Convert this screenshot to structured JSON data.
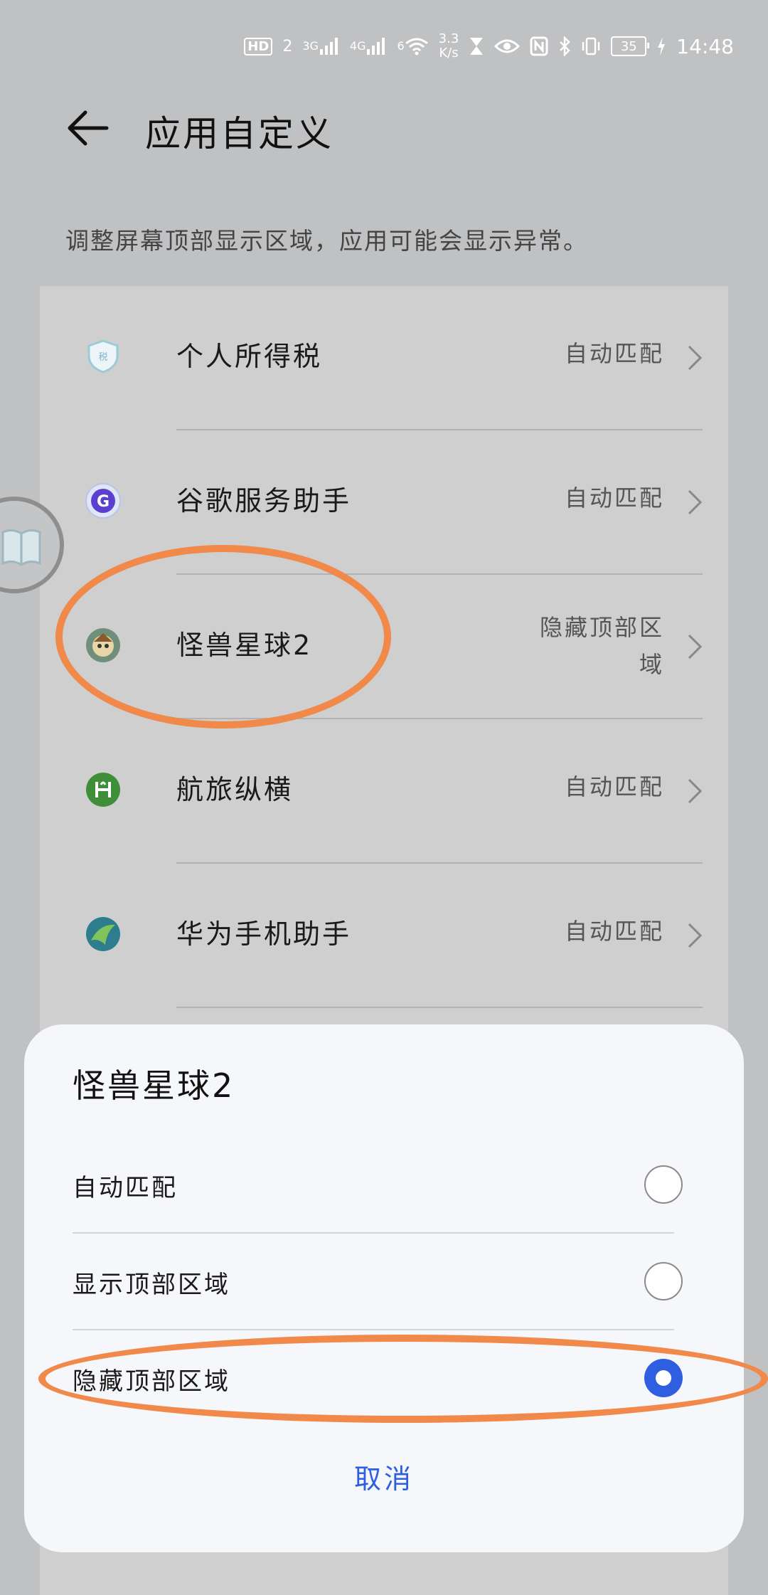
{
  "status_bar": {
    "hd": "HD",
    "sim": "2",
    "net1": "3G",
    "net2": "4G",
    "net3": "6",
    "speed_value": "3.3",
    "speed_unit": "K/s",
    "battery": "35",
    "time": "14:48"
  },
  "header": {
    "title": "应用自定义",
    "back_icon": "back-arrow-icon"
  },
  "subtitle": "调整屏幕顶部显示区域，应用可能会显示异常。",
  "apps": [
    {
      "name": "个人所得税",
      "value": "自动匹配",
      "icon": "tax-shield-icon",
      "icon_color": "#dfe9ee"
    },
    {
      "name": "谷歌服务助手",
      "value": "自动匹配",
      "icon": "google-g-icon",
      "icon_color": "#5b3fd1"
    },
    {
      "name": "怪兽星球2",
      "value": "隐藏顶部区域",
      "value_line1": "隐藏顶部区",
      "value_line2": "域",
      "icon": "monster-planet-icon",
      "icon_color": "#7b6a4a"
    },
    {
      "name": "航旅纵横",
      "value": "自动匹配",
      "icon": "travel-icon",
      "icon_color": "#3e8e3a"
    },
    {
      "name": "华为手机助手",
      "value": "自动匹配",
      "icon": "phone-assistant-icon",
      "icon_color": "#2e7d8f"
    }
  ],
  "sheet": {
    "title": "怪兽星球2",
    "options": [
      {
        "label": "自动匹配",
        "selected": false
      },
      {
        "label": "显示顶部区域",
        "selected": false
      },
      {
        "label": "隐藏顶部区域",
        "selected": true
      }
    ],
    "cancel_label": "取消"
  },
  "colors": {
    "accent": "#2f5fe0",
    "annotation": "#f0894a",
    "background": "#c0c1c3"
  }
}
